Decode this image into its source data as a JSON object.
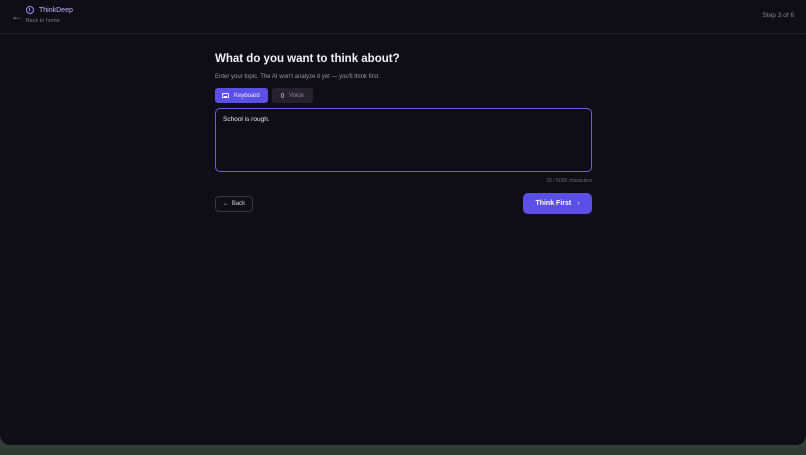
{
  "header": {
    "back_icon": "←",
    "brand_name": "ThinkDeep",
    "back_to_home": "Back to home",
    "step": "Step 3 of 6"
  },
  "main": {
    "title": "What do you want to think about?",
    "subtitle": "Enter your topic. The AI won't analyze it yet — you'll think first.",
    "tabs": [
      {
        "label": "Keyboard",
        "icon": "keyboard-icon",
        "active": true
      },
      {
        "label": "Voice",
        "icon": "mic-icon",
        "active": false
      }
    ],
    "input_value": "School is rough.",
    "char_count": "16 / 5000 characters"
  },
  "actions": {
    "back_icon": "←",
    "back_label": "Back",
    "next_label": "Think First",
    "next_icon": "›"
  },
  "colors": {
    "background": "#0f0d15",
    "accent": "#5b4fe6",
    "brand": "#c4b5fd"
  }
}
